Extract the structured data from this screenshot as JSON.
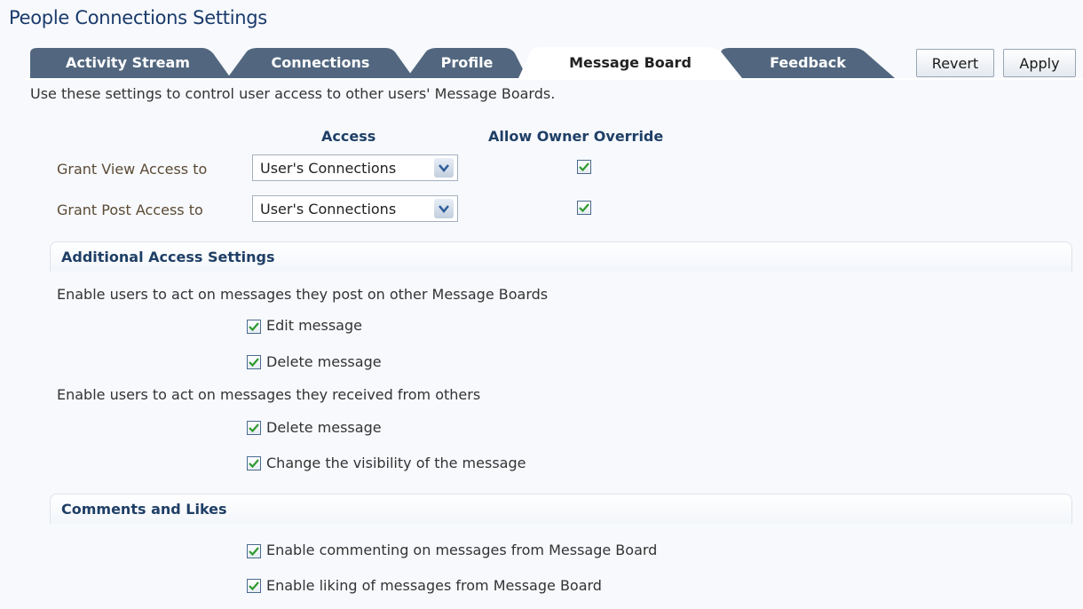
{
  "page": {
    "title": "People Connections Settings"
  },
  "tabs": [
    {
      "label": "Activity Stream",
      "active": false
    },
    {
      "label": "Connections",
      "active": false
    },
    {
      "label": "Profile",
      "active": false
    },
    {
      "label": "Message Board",
      "active": true
    },
    {
      "label": "Feedback",
      "active": false
    }
  ],
  "toolbar": {
    "revert_label": "Revert",
    "apply_label": "Apply"
  },
  "intro": "Use these settings to control user access to other users' Message Boards.",
  "access_table": {
    "col_access": "Access",
    "col_override": "Allow Owner Override",
    "rows": [
      {
        "label": "Grant View Access to",
        "value": "User's Connections",
        "override_checked": true
      },
      {
        "label": "Grant Post Access to",
        "value": "User's Connections",
        "override_checked": true
      }
    ]
  },
  "additional": {
    "title": "Additional Access Settings",
    "group1_text": "Enable users to act on messages they post on other Message Boards",
    "group1_options": [
      {
        "label": "Edit message",
        "checked": true
      },
      {
        "label": "Delete message",
        "checked": true
      }
    ],
    "group2_text": "Enable users to act on messages they received from others",
    "group2_options": [
      {
        "label": "Delete message",
        "checked": true
      },
      {
        "label": "Change the visibility of the message",
        "checked": true
      }
    ]
  },
  "comments": {
    "title": "Comments and Likes",
    "options": [
      {
        "label": "Enable commenting on messages from Message Board",
        "checked": true
      },
      {
        "label": "Enable liking of messages from Message Board",
        "checked": true
      }
    ]
  },
  "colors": {
    "tab_inactive": "#52677f",
    "tab_active": "#ffffff",
    "title": "#1a3a6c",
    "check": "#2e9a2e"
  },
  "icons": {
    "checkbox": "checkmark-icon",
    "dropdown": "chevron-down-icon"
  }
}
